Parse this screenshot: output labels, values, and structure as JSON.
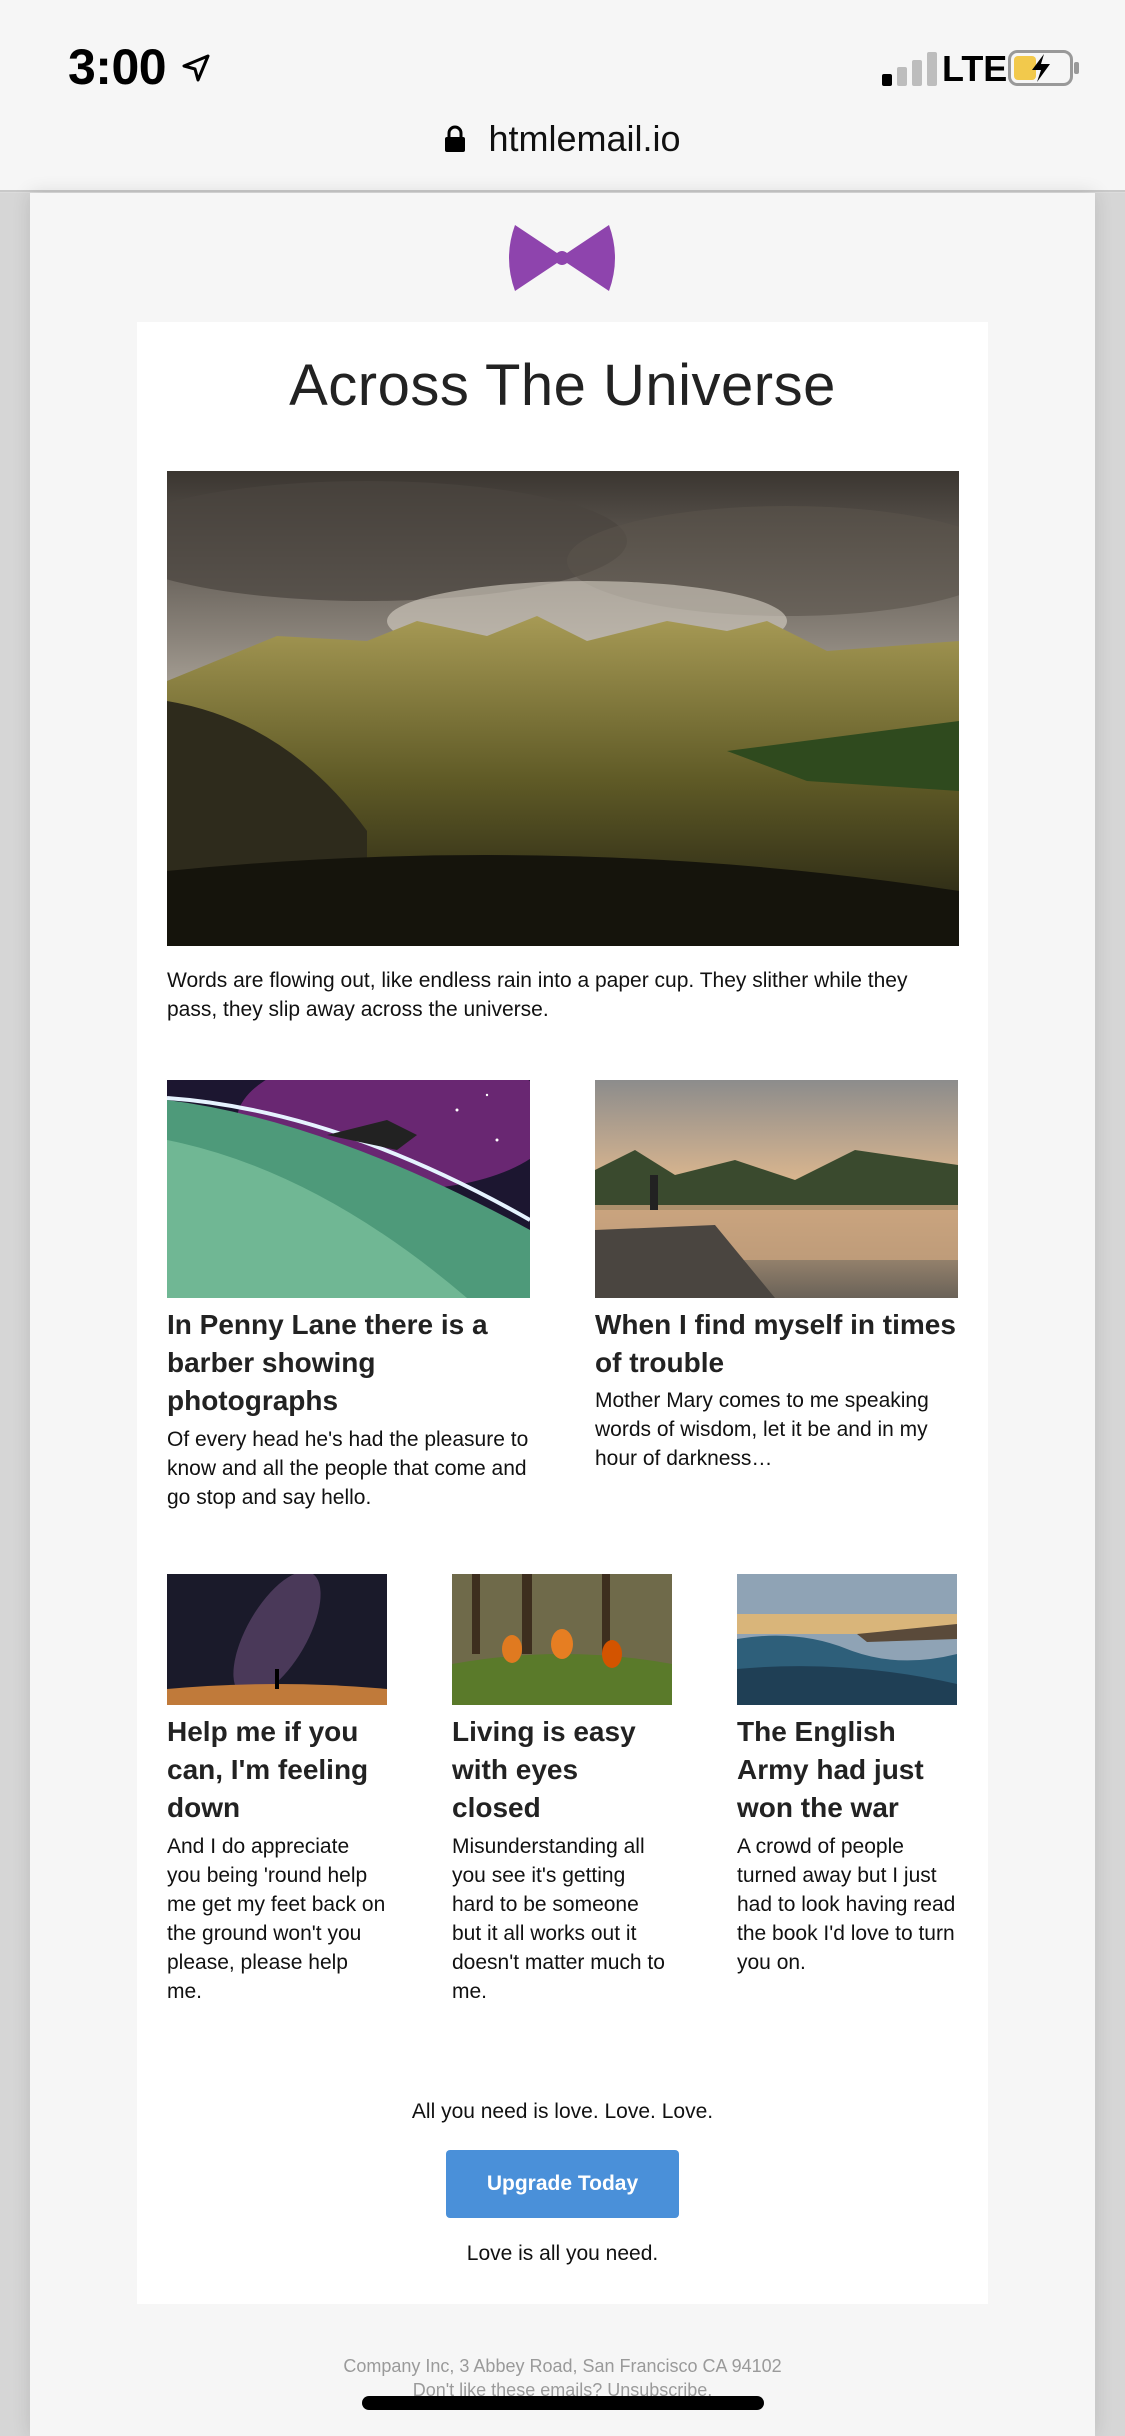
{
  "status_bar": {
    "time": "3:00",
    "network": "LTE",
    "icons": [
      "location-arrow-icon",
      "signal-bars-icon",
      "battery-charging-icon"
    ]
  },
  "browser": {
    "url": "htmlemail.io",
    "icons": [
      "lock-icon"
    ]
  },
  "email": {
    "logo": "bow-tie-logo",
    "brand_color": "#8e44ad",
    "title": "Across The Universe",
    "lead_text": "Words are flowing out, like endless rain into a paper cup. They slither while they pass, they slip away across the universe.",
    "two_column": [
      {
        "title": "In Penny Lane there is a barber showing photographs",
        "text": "Of every head he's had the pleasure to know and all the people that come and go stop and say hello."
      },
      {
        "title": "When I find myself in times of trouble",
        "text": "Mother Mary comes to me speaking words of wisdom, let it be and in my hour of darkness…"
      }
    ],
    "three_column": [
      {
        "title": "Help me if you can, I'm feeling down",
        "text": "And I do appreciate you being 'round help me get my feet back on the ground won't you please, please help me."
      },
      {
        "title": "Living is easy with eyes closed",
        "text": "Misunderstanding all you see it's getting hard to be someone but it all works out it doesn't matter much to me."
      },
      {
        "title": "The English Army had just won the war",
        "text": "A crowd of people turned away but I just had to look having read the book I'd love to turn you on."
      }
    ],
    "cta": {
      "top_text": "All you need is love. Love. Love.",
      "button_label": "Upgrade Today",
      "button_color": "#4a90d9",
      "bottom_text": "Love is all you need."
    },
    "footer": {
      "address": "Company Inc, 3 Abbey Road, San Francisco CA 94102",
      "unsubscribe_prefix": "Don't like these emails?",
      "unsubscribe_link": "Unsubscribe."
    }
  }
}
